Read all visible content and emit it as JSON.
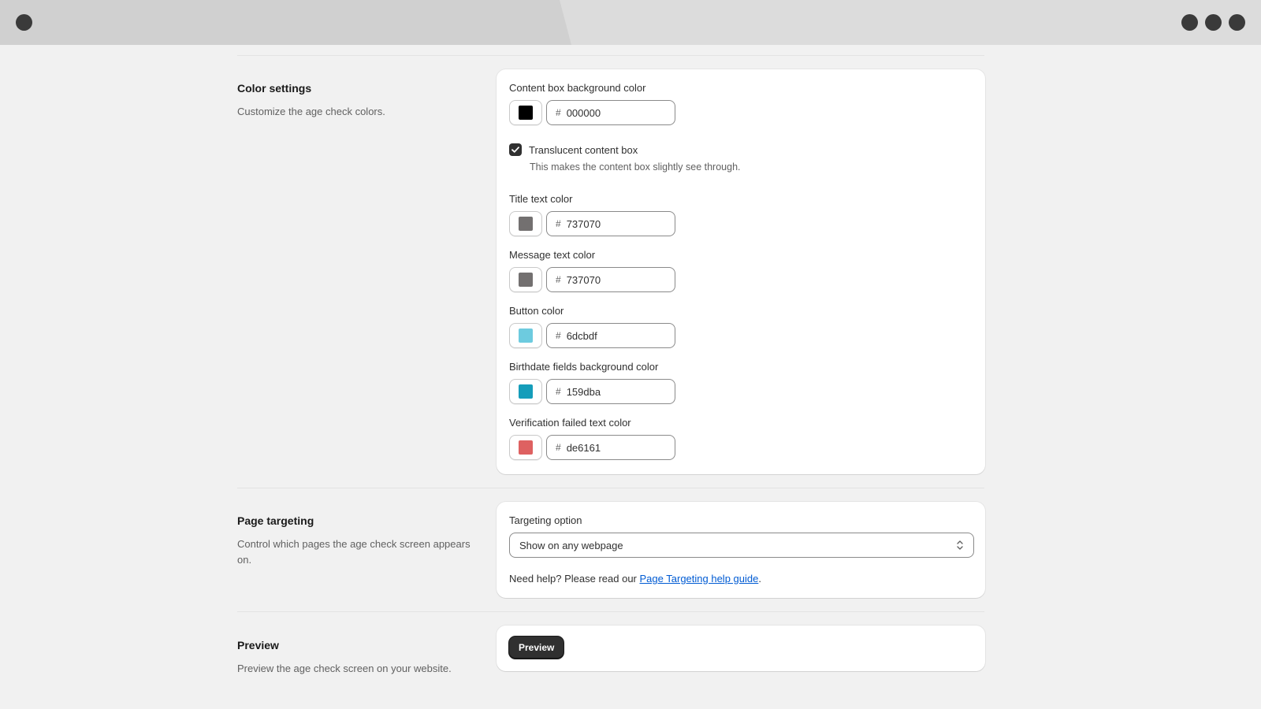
{
  "color_settings": {
    "title": "Color settings",
    "description": "Customize the age check colors.",
    "fields": [
      {
        "label": "Content box background color",
        "value": "000000",
        "color": "#000000"
      },
      {
        "label": "Title text color",
        "value": "737070",
        "color": "#737070"
      },
      {
        "label": "Message text color",
        "value": "737070",
        "color": "#737070"
      },
      {
        "label": "Button color",
        "value": "6dcbdf",
        "color": "#6dcbdf"
      },
      {
        "label": "Birthdate fields background color",
        "value": "159dba",
        "color": "#159dba"
      },
      {
        "label": "Verification failed text color",
        "value": "de6161",
        "color": "#de6161"
      }
    ],
    "hash_symbol": "#",
    "translucent": {
      "label": "Translucent content box",
      "help": "This makes the content box slightly see through.",
      "checked": true
    }
  },
  "page_targeting": {
    "title": "Page targeting",
    "description": "Control which pages the age check screen appears on.",
    "select_label": "Targeting option",
    "select_value": "Show on any webpage",
    "help_prefix": "Need help? Please read our ",
    "help_link": "Page Targeting help guide",
    "help_suffix": "."
  },
  "preview": {
    "title": "Preview",
    "description": "Preview the age check screen on your website.",
    "button_label": "Preview"
  },
  "icons": {
    "checkbox": "checkmark-icon",
    "select": "select-chevrons-icon",
    "window": "window-control-dot-icon"
  }
}
